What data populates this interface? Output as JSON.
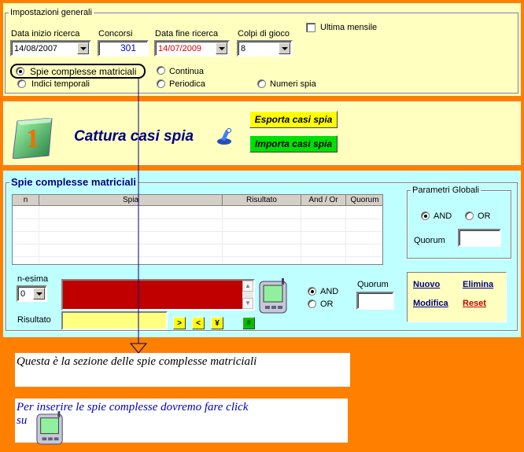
{
  "settings": {
    "title": "Impostazioni generali",
    "date_start_label": "Data inizio ricerca",
    "date_start_value": "14/08/2007",
    "concorsi_label": "Concorsi",
    "concorsi_value": "301",
    "date_end_label": "Data fine ricerca",
    "date_end_value": "14/07/2009",
    "colpi_label": "Colpi di gioco",
    "colpi_value": "8",
    "ultima_mensile_label": "Ultima mensile",
    "ultima_mensile_checked": false,
    "modes": [
      {
        "label": "Spie complesse matriciali",
        "selected": true
      },
      {
        "label": "Indici temporali",
        "selected": false
      },
      {
        "label": "Continua",
        "selected": false
      },
      {
        "label": "Periodica",
        "selected": false
      },
      {
        "label": "Numeri spia",
        "selected": false
      }
    ]
  },
  "capture": {
    "title": "Cattura casi spia",
    "step_number": "1",
    "export_label": "Esporta casi spia",
    "import_label": "Importa casi spia"
  },
  "spie": {
    "title": "Spie complesse matriciali",
    "columns": [
      "n",
      "Spia",
      "Risultato",
      "And / Or",
      "Quorum"
    ],
    "nesima_label": "n-esima",
    "nesima_value": "0",
    "risultato_label": "Risultato",
    "and_label": "AND",
    "or_label": "OR",
    "quorum_label": "Quorum",
    "buttons": {
      "gt": ">",
      "lt": "<",
      "yen": "¥",
      "hash": "#"
    },
    "global": {
      "title": "Parametri Globali",
      "and_label": "AND",
      "or_label": "OR",
      "quorum_label": "Quorum"
    },
    "actions": {
      "nuovo": "Nuovo",
      "elimina": "Elimina",
      "modifica": "Modifica",
      "reset": "Reset"
    }
  },
  "notes": {
    "note1": "Questa è la sezione delle spie complesse matriciali",
    "note2_line1": "Per inserire le spie complesse dovremo fare click",
    "note2_line2": "su"
  },
  "colors": {
    "background": "#ff8000",
    "panel_yellow": "#ffffc0",
    "panel_cyan": "#c0ffff",
    "spia_field": "#c00000",
    "risultato_field": "#ffff80",
    "accent_blue": "#000080"
  }
}
